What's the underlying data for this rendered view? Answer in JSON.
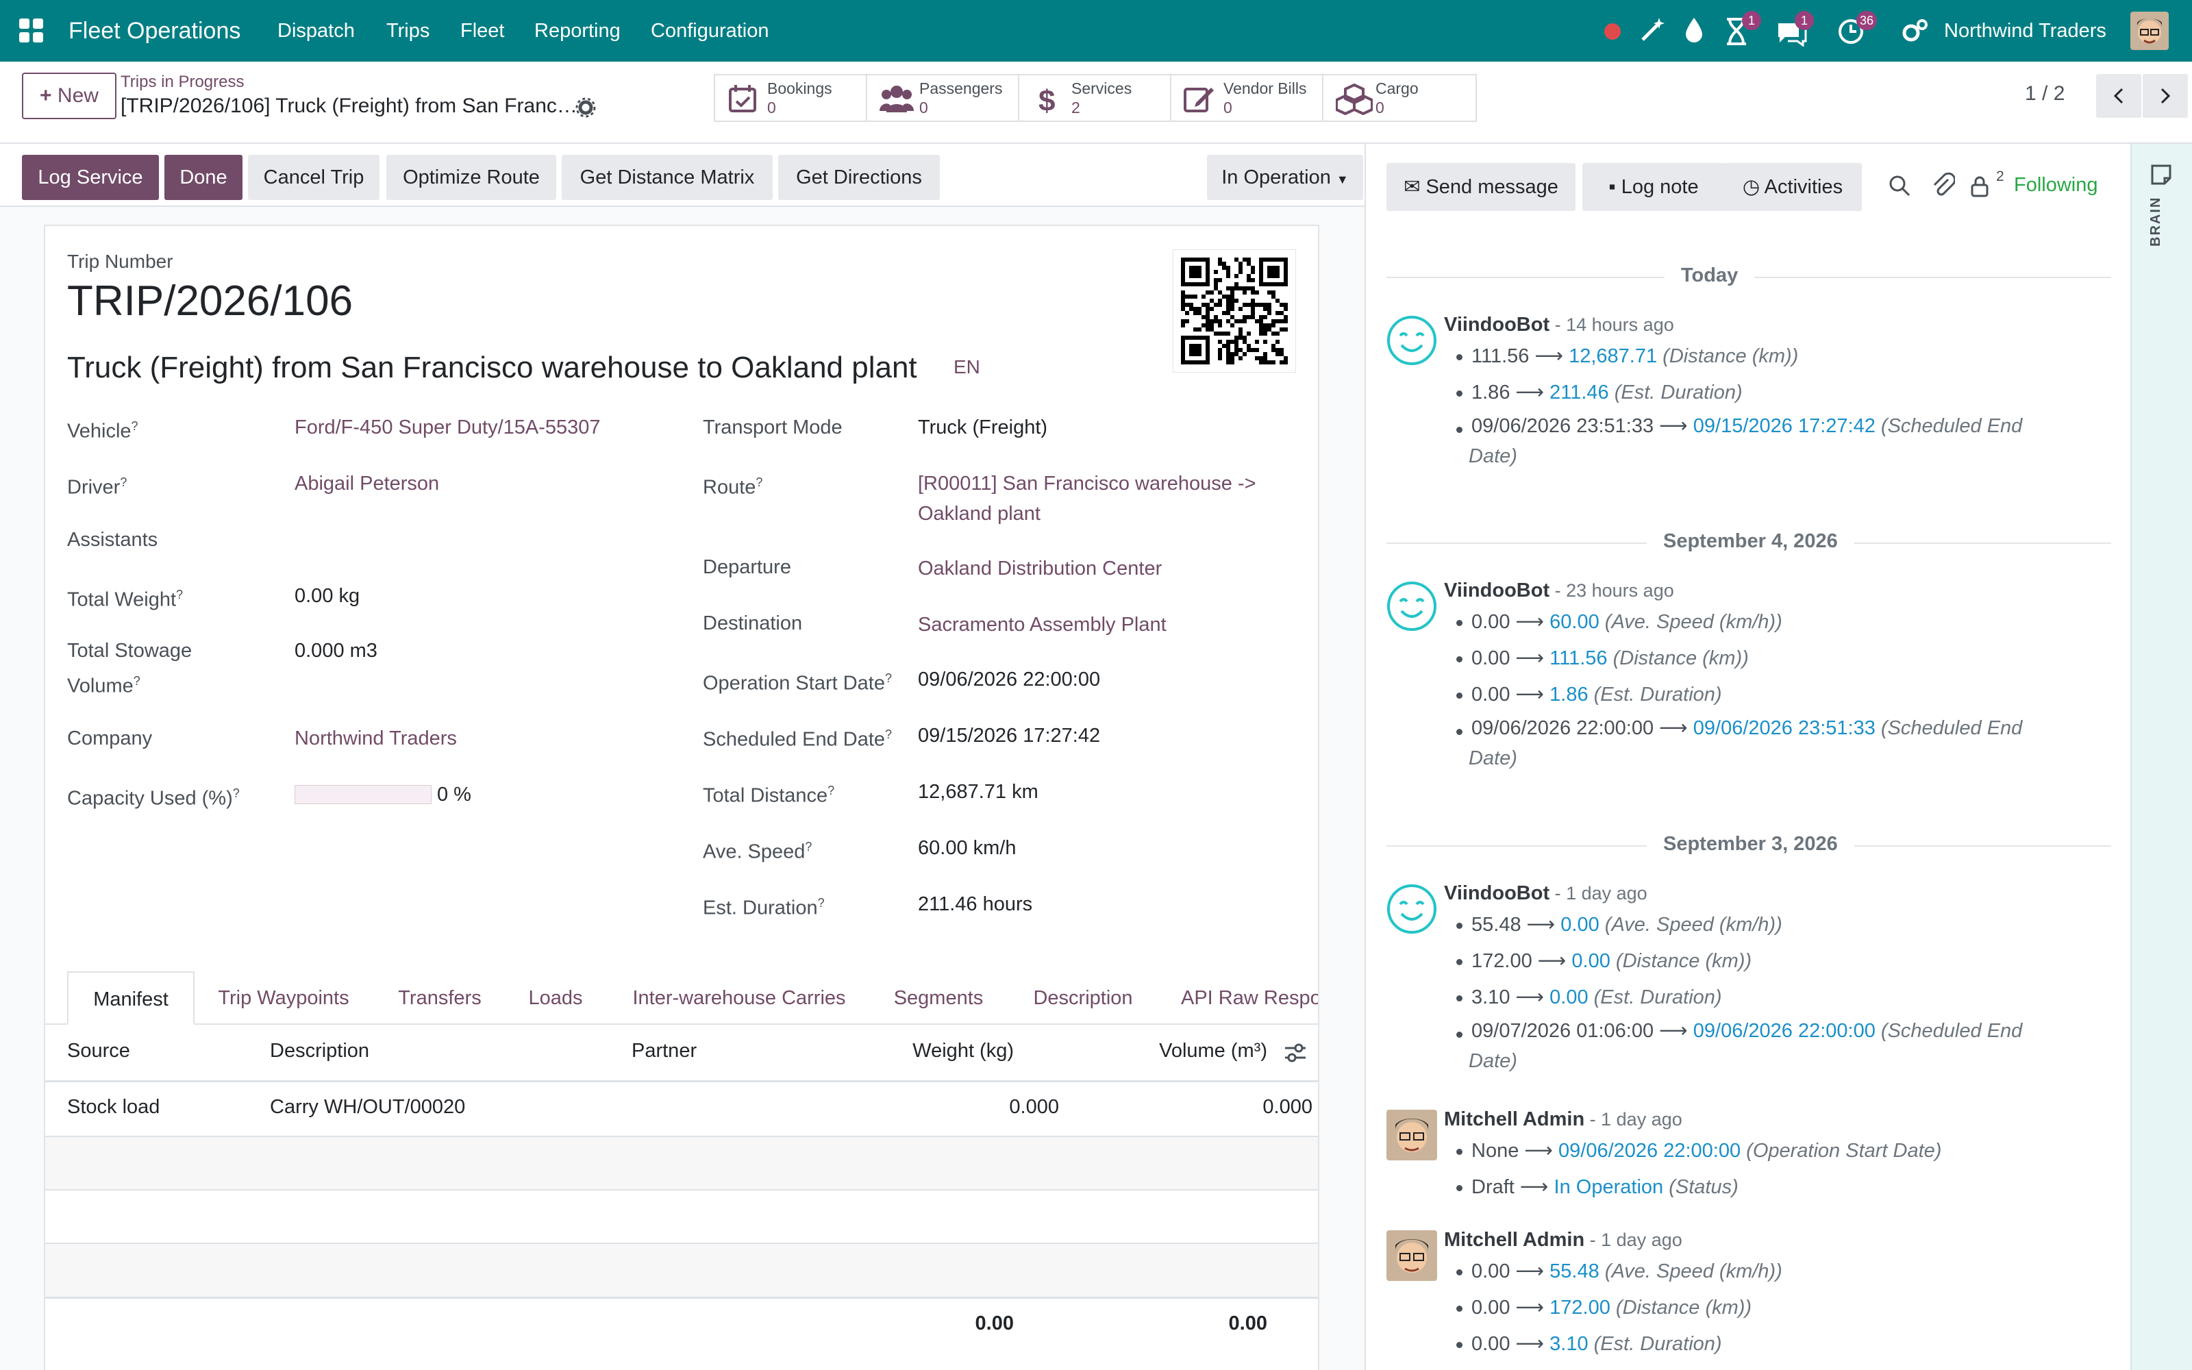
{
  "topbar": {
    "app_name": "Fleet Operations",
    "menus": [
      "Dispatch",
      "Trips",
      "Fleet",
      "Reporting",
      "Configuration"
    ],
    "company": "Northwind Traders",
    "badges": {
      "activity_timer": "1",
      "messages": "1",
      "clock": "36"
    }
  },
  "control_panel": {
    "new_label": "New",
    "breadcrumb_parent": "Trips in Progress",
    "breadcrumb_current": "[TRIP/2026/106] Truck (Freight) from San Franc…",
    "pager": "1 / 2",
    "smart_buttons": [
      {
        "label": "Bookings",
        "count": "0"
      },
      {
        "label": "Passengers",
        "count": "0"
      },
      {
        "label": "Services",
        "count": "2"
      },
      {
        "label": "Vendor Bills",
        "count": "0"
      },
      {
        "label": "Cargo",
        "count": "0"
      }
    ]
  },
  "action_bar": {
    "log_service": "Log Service",
    "done": "Done",
    "cancel_trip": "Cancel Trip",
    "optimize_route": "Optimize Route",
    "get_distance_matrix": "Get Distance Matrix",
    "get_directions": "Get Directions",
    "status": "In Operation"
  },
  "form": {
    "trip_number_label": "Trip Number",
    "trip_number": "TRIP/2026/106",
    "name": "Truck (Freight) from San Francisco warehouse to Oakland plant",
    "lang": "EN",
    "left_fields": {
      "vehicle_label": "Vehicle",
      "vehicle": "Ford/F-450 Super Duty/15A-55307",
      "driver_label": "Driver",
      "driver": "Abigail Peterson",
      "assistants_label": "Assistants",
      "total_weight_label": "Total Weight",
      "total_weight": "0.00 kg",
      "stowage_label_1": "Total Stowage",
      "stowage_label_2": "Volume",
      "stowage": "0.000 m3",
      "company_label": "Company",
      "company": "Northwind Traders",
      "capacity_label": "Capacity Used (%)",
      "capacity": "0 %",
      "capacity_fraction": 0
    },
    "right_fields": {
      "transport_mode_label": "Transport Mode",
      "transport_mode": "Truck (Freight)",
      "route_label": "Route",
      "route_1": "[R00011] San Francisco warehouse ->",
      "route_2": "Oakland plant",
      "departure_label": "Departure",
      "departure": "Oakland Distribution Center",
      "destination_label": "Destination",
      "destination": "Sacramento Assembly Plant",
      "op_start_label": "Operation Start Date",
      "op_start": "09/06/2026 22:00:00",
      "sched_end_label": "Scheduled End Date",
      "sched_end": "09/15/2026 17:27:42",
      "total_distance_label": "Total Distance",
      "total_distance": "12,687.71 km",
      "ave_speed_label": "Ave. Speed",
      "ave_speed": "60.00 km/h",
      "est_duration_label": "Est. Duration",
      "est_duration": "211.46 hours"
    },
    "tabs": [
      "Manifest",
      "Trip Waypoints",
      "Transfers",
      "Loads",
      "Inter-warehouse Carries",
      "Segments",
      "Description",
      "API Raw Respo"
    ],
    "table": {
      "headers": [
        "Source",
        "Description",
        "Partner",
        "Weight (kg)",
        "Volume (m³)"
      ],
      "rows": [
        [
          "Stock load",
          "Carry WH/OUT/00020",
          "",
          "0.000",
          "0.000"
        ]
      ],
      "totals": [
        "0.00",
        "0.00"
      ]
    }
  },
  "chatter": {
    "send_message": "Send message",
    "log_note": "Log note",
    "activities": "Activities",
    "followers_count": "2",
    "following": "Following",
    "side_label": "BRAIN",
    "groups": [
      {
        "date": "Today"
      },
      {
        "date": "September 4, 2026"
      },
      {
        "date": "September 3, 2026"
      }
    ],
    "messages": [
      {
        "author": "ViindooBot",
        "ago": " - 14 hours ago",
        "changes": [
          {
            "old": "111.56",
            "new": "12,687.71",
            "field": "(Distance (km))"
          },
          {
            "old": "1.86",
            "new": "211.46",
            "field": "(Est. Duration)"
          },
          {
            "old": "09/06/2026 23:51:33",
            "new": "09/15/2026 17:27:42",
            "field": "(Scheduled End",
            "field2": "Date)"
          }
        ]
      },
      {
        "author": "ViindooBot",
        "ago": " - 23 hours ago",
        "changes": [
          {
            "old": "0.00",
            "new": "60.00",
            "field": "(Ave. Speed (km/h))"
          },
          {
            "old": "0.00",
            "new": "111.56",
            "field": "(Distance (km))"
          },
          {
            "old": "0.00",
            "new": "1.86",
            "field": "(Est. Duration)"
          },
          {
            "old": "09/06/2026 22:00:00",
            "new": "09/06/2026 23:51:33",
            "field": "(Scheduled End",
            "field2": "Date)"
          }
        ]
      },
      {
        "author": "ViindooBot",
        "ago": " - 1 day ago",
        "changes": [
          {
            "old": "55.48",
            "new": "0.00",
            "field": "(Ave. Speed (km/h))"
          },
          {
            "old": "172.00",
            "new": "0.00",
            "field": "(Distance (km))"
          },
          {
            "old": "3.10",
            "new": "0.00",
            "field": "(Est. Duration)"
          },
          {
            "old": "09/07/2026 01:06:00",
            "new": "09/06/2026 22:00:00",
            "field": "(Scheduled End",
            "field2": "Date)"
          }
        ]
      },
      {
        "author": "Mitchell Admin",
        "ago": " - 1 day ago",
        "changes": [
          {
            "old": "None",
            "new": "09/06/2026 22:00:00",
            "field": "(Operation Start Date)"
          },
          {
            "old": "Draft",
            "new": "In Operation",
            "field": "(Status)"
          }
        ]
      },
      {
        "author": "Mitchell Admin",
        "ago": " - 1 day ago",
        "changes": [
          {
            "old": "0.00",
            "new": "55.48",
            "field": "(Ave. Speed (km/h))"
          },
          {
            "old": "0.00",
            "new": "172.00",
            "field": "(Distance (km))"
          },
          {
            "old": "0.00",
            "new": "3.10",
            "field": "(Est. Duration)"
          }
        ]
      }
    ]
  },
  "colors": {
    "brand": "#017e84",
    "primary": "#714b67",
    "link_blue": "#1a8fc9"
  }
}
